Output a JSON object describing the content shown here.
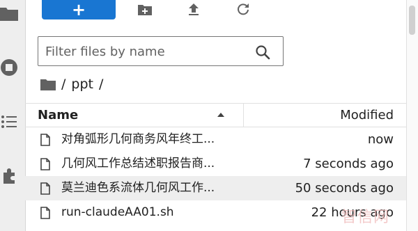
{
  "toolbar": {
    "new_label": "+"
  },
  "filter": {
    "placeholder": "Filter files by name",
    "value": ""
  },
  "breadcrumb": {
    "root": "/",
    "folder": "ppt",
    "trailing": "/"
  },
  "listing": {
    "headers": {
      "name": "Name",
      "modified": "Modified"
    },
    "sort": "ascending",
    "files": [
      {
        "name": "对角弧形几何商务风年终工...",
        "modified": "now",
        "icon": "file-icon",
        "selected": false
      },
      {
        "name": "几何风工作总结述职报告商...",
        "modified": "7 seconds ago",
        "icon": "file-icon",
        "selected": false
      },
      {
        "name": "莫兰迪色系流体几何风工作...",
        "modified": "50 seconds ago",
        "icon": "file-icon",
        "selected": true
      },
      {
        "name": "run-claudeAA01.sh",
        "modified": "22 hours ago",
        "icon": "file-icon",
        "selected": false
      }
    ]
  },
  "watermark": {
    "text": "智信网"
  },
  "colors": {
    "accent": "#1976d2",
    "selected_row": "#eeeeee",
    "sidebar": "#eeeeee"
  }
}
